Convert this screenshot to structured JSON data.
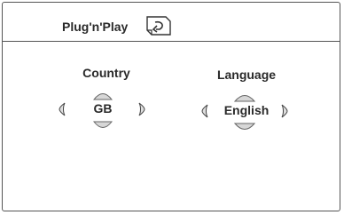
{
  "header": {
    "title": "Plug'n'Play",
    "icon": "return-icon"
  },
  "settings": [
    {
      "label": "Country",
      "value": "GB"
    },
    {
      "label": "Language",
      "value": "English"
    }
  ],
  "icons": {
    "left": "chevron-left-icon",
    "right": "chevron-right-icon",
    "up": "up-arrow-icon",
    "down": "down-arrow-icon"
  }
}
